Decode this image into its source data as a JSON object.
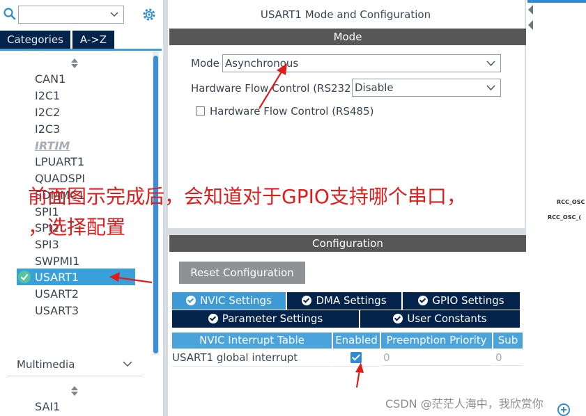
{
  "left_panel": {
    "tabs": {
      "categories": "Categories",
      "az": "A->Z"
    },
    "items": [
      "CAN1",
      "I2C1",
      "I2C2",
      "I2C3",
      "IRTIM",
      "LPUART1",
      "QUADSPI",
      "SDMMC1",
      "SPI1",
      "SPI2",
      "SPI3",
      "SWPMI1",
      "USART1",
      "USART2",
      "USART3"
    ],
    "multimedia_label": "Multimedia",
    "multimedia_items": [
      "SAI1"
    ]
  },
  "mode_panel": {
    "title": "USART1 Mode and Configuration",
    "header": "Mode",
    "mode_label": "Mode",
    "mode_value": "Asynchronous",
    "hwflow232_label": "Hardware Flow Control (RS232)",
    "hwflow232_value": "Disable",
    "hwflow485_label": "Hardware Flow Control (RS485)"
  },
  "config_panel": {
    "header": "Configuration",
    "reset_label": "Reset Configuration",
    "tabs": {
      "nvic": "NVIC Settings",
      "dma": "DMA Settings",
      "gpio": "GPIO Settings",
      "param": "Parameter Settings",
      "user": "User Constants"
    },
    "table": {
      "headers": [
        "NVIC Interrupt Table",
        "Enabled",
        "Preemption Priority",
        "Sub"
      ],
      "rows": [
        {
          "name": "USART1 global interrupt",
          "preemption": "0",
          "sub": "0"
        }
      ]
    }
  },
  "canvas": {
    "label1": "RCC_OSC",
    "label2": "RCC_OSC_("
  },
  "annotations": {
    "line1": "前面图示完成后，会知道对于GPIO支持哪个串口，",
    "line2": "，选择配置"
  },
  "watermark": "CSDN @茫茫人海中，我欣赏你",
  "colors": {
    "navy": "#03234b",
    "accent": "#39a0d9",
    "header_gray": "#575757",
    "annotation_red": "#e21b1b"
  },
  "icons": [
    "search-icon",
    "chevron-down-icon",
    "gear-icon",
    "check-circle-icon",
    "zoom-icon"
  ]
}
